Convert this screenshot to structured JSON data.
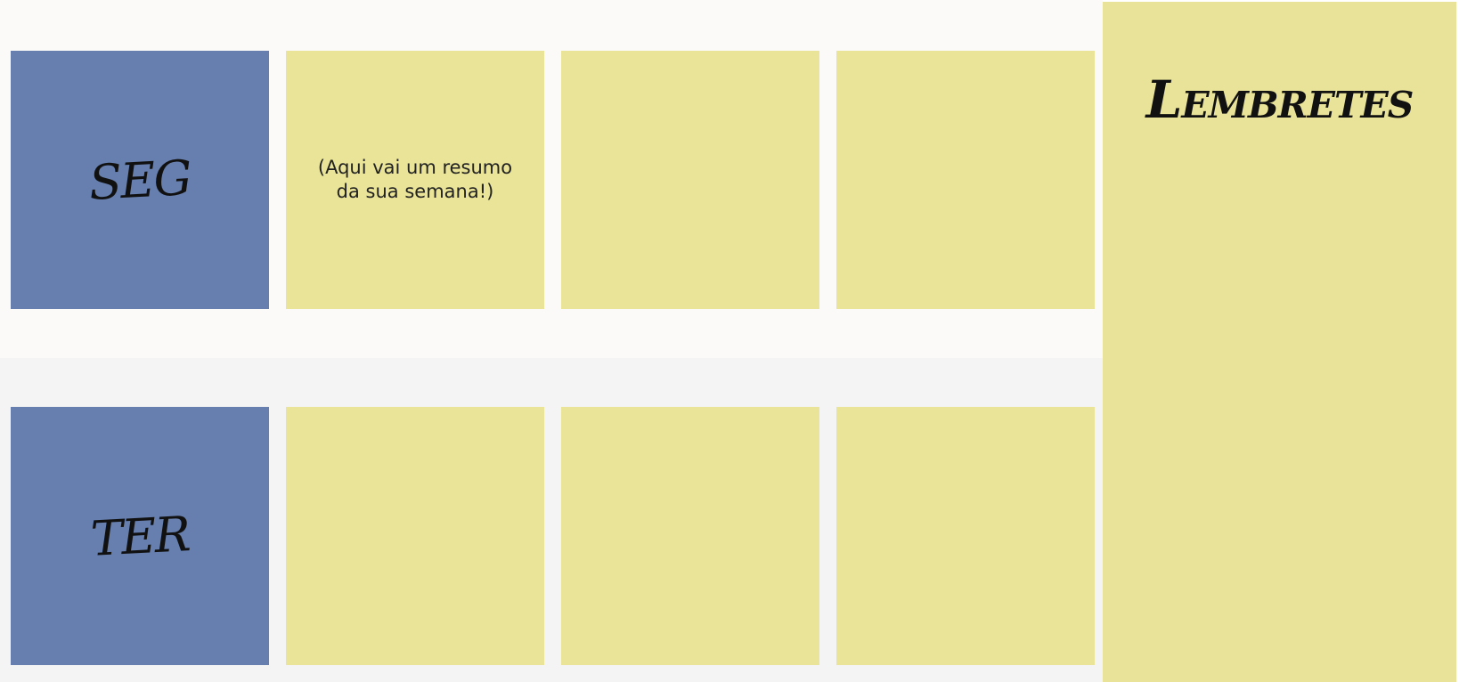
{
  "week": {
    "rows": [
      {
        "day_label": "SEG",
        "summary": "(Aqui vai um resumo da sua semana!)"
      },
      {
        "day_label": "TER",
        "summary": ""
      }
    ]
  },
  "reminders": {
    "title": "Lembretes"
  },
  "colors": {
    "day_card": "#667fae",
    "note_card": "#e9e498",
    "reminders_panel": "#e8e398",
    "row_1_background": "#fbfaf8",
    "row_2_background": "#f4f4f4"
  }
}
